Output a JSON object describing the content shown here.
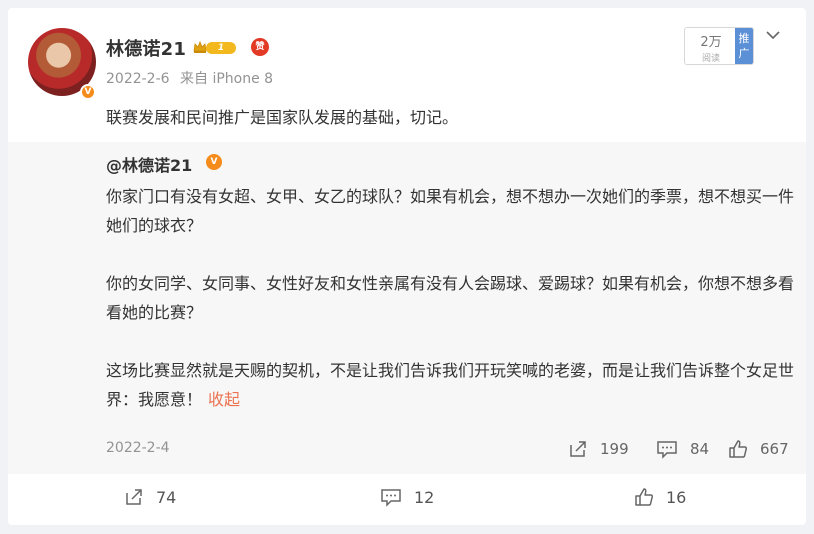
{
  "post": {
    "author": "林德诺21",
    "level": "1",
    "avatar_badge": "V",
    "vip_badge": "赞",
    "date": "2022-2-6",
    "source": "来自 iPhone 8",
    "text": "联赛发展和民间推广是国家队发展的基础，切记。",
    "reads": "2万",
    "reads_label": "阅读",
    "promote_label": "推广"
  },
  "original": {
    "author": "@林德诺21",
    "verified_badge": "V",
    "paragraphs": [
      "你家门口有没有女超、女甲、女乙的球队？如果有机会，想不想办一次她们的季票，想不想买一件她们的球衣？",
      "你的女同学、女同事、女性好友和女性亲属有没有人会踢球、爱踢球？如果有机会，你想不想多看看她的比赛？",
      "这场比赛显然就是天赐的契机，不是让我们告诉我们开玩笑喊的老婆，而是让我们告诉整个女足世界：我愿意！"
    ],
    "collapse_label": "收起",
    "date": "2022-2-4",
    "reposts": "199",
    "comments": "84",
    "likes": "667"
  },
  "footer": {
    "reposts": "74",
    "comments": "12",
    "likes": "16"
  },
  "colors": {
    "link": "#eb7350",
    "verified": "#f58b1b",
    "promote": "#5b8fd6",
    "level_badge": "#f3b81d"
  }
}
